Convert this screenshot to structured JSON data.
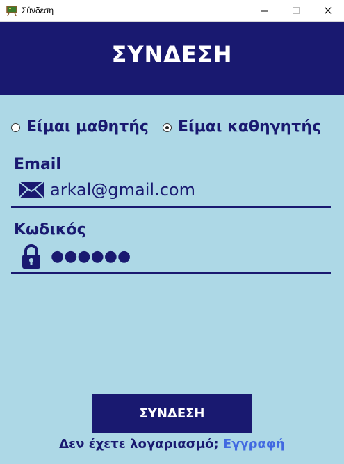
{
  "window": {
    "title": "Σύνδεση",
    "icon": "app-board-icon"
  },
  "header": {
    "title": "ΣΥΝΔΕΣΗ"
  },
  "role_selector": {
    "student_label": "Είμαι μαθητής",
    "teacher_label": "Είμαι καθηγητής",
    "selected": "teacher"
  },
  "email": {
    "label": "Email",
    "value": "arkal@gmail.com",
    "icon": "envelope-icon"
  },
  "password": {
    "label": "Κωδικός",
    "masked_value": "●●●●●●",
    "icon": "lock-icon"
  },
  "login_button": {
    "label": "ΣΥΝΔΕΣΗ"
  },
  "footer": {
    "prompt": "Δεν έχετε λογαριασμό;",
    "register_link": "Εγγραφή"
  },
  "colors": {
    "background": "#ADD8E6",
    "primary": "#191970",
    "link": "#4169E1"
  }
}
